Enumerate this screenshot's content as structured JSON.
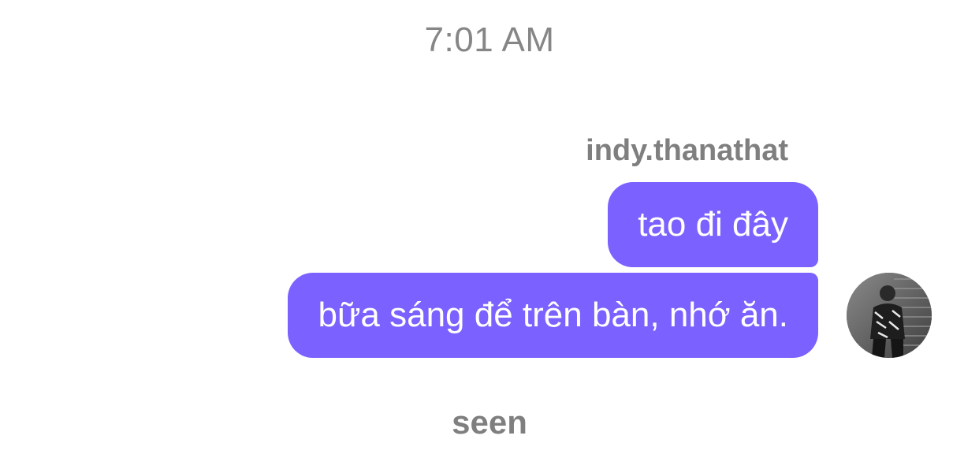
{
  "conversation": {
    "timestamp": "7:01 AM",
    "sender_name": "indy.thanathat",
    "messages": [
      {
        "text": "tao đi đây"
      },
      {
        "text": "bữa sáng để trên bàn, nhớ ăn."
      }
    ],
    "status": "seen"
  },
  "theme": {
    "bubble_color": "#7b61ff",
    "bubble_text_color": "#ffffff",
    "meta_text_color": "#868686"
  },
  "avatar": {
    "icon": "user-avatar-photo"
  }
}
